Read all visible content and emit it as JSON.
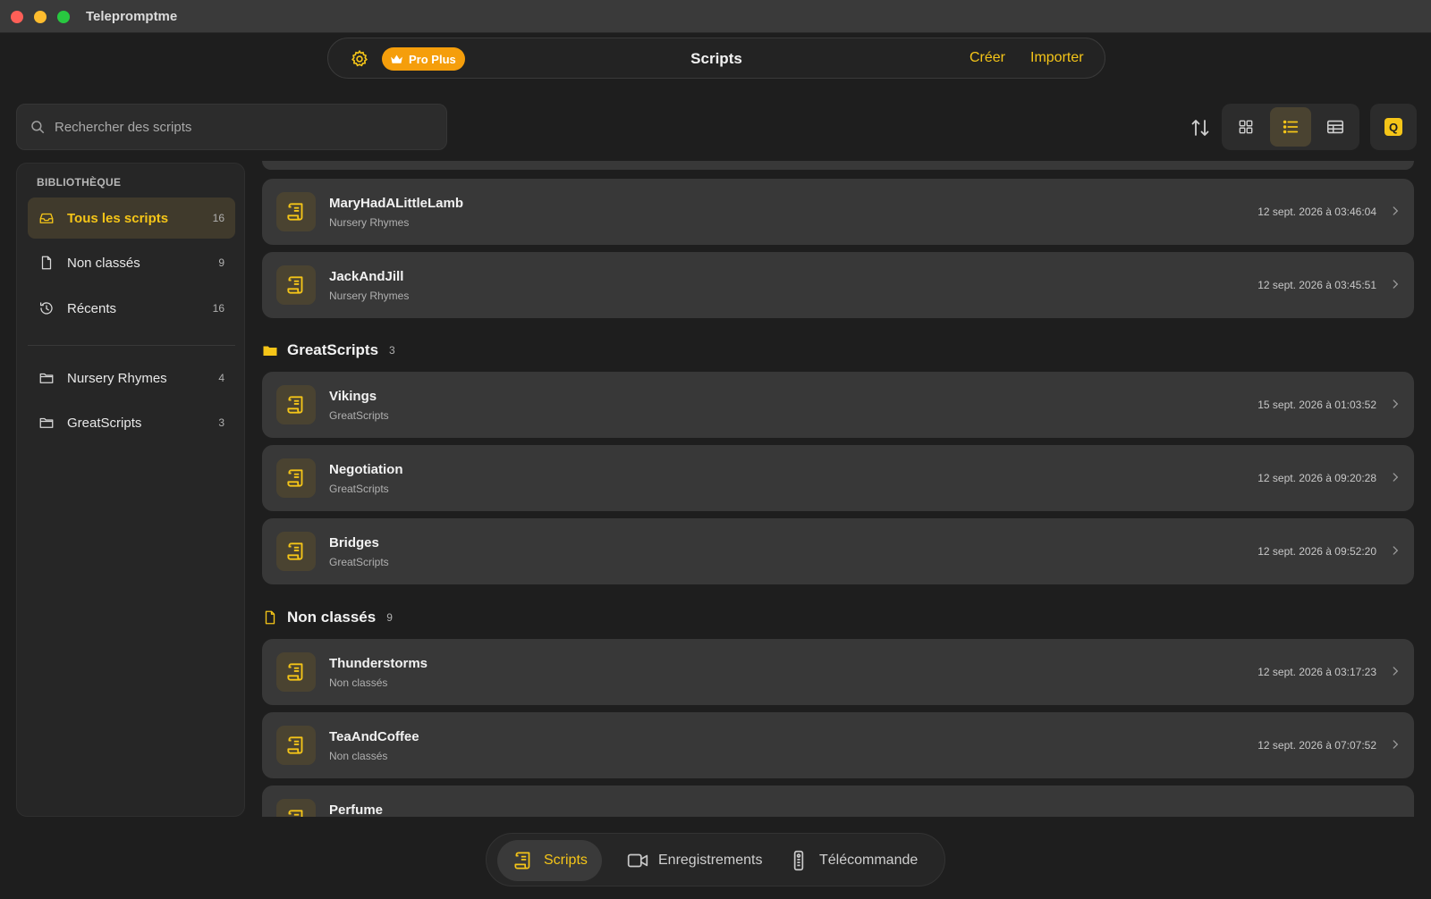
{
  "window": {
    "title": "Telepromptme"
  },
  "topnav": {
    "badge": "Pro Plus",
    "title": "Scripts",
    "create_label": "Créer",
    "import_label": "Importer"
  },
  "search": {
    "placeholder": "Rechercher des scripts"
  },
  "toolbar": {
    "q_label": "Q"
  },
  "sidebar": {
    "header": "BIBLIOTHÈQUE",
    "items": [
      {
        "label": "Tous les scripts",
        "count": "16",
        "icon": "tray-icon"
      },
      {
        "label": "Non classés",
        "count": "9",
        "icon": "document-icon"
      },
      {
        "label": "Récents",
        "count": "16",
        "icon": "clock-history-icon"
      }
    ],
    "folders": [
      {
        "label": "Nursery Rhymes",
        "count": "4",
        "icon": "folder-icon"
      },
      {
        "label": "GreatScripts",
        "count": "3",
        "icon": "folder-icon"
      }
    ]
  },
  "content": {
    "nursery": [
      {
        "title": "MaryHadALittleLamb",
        "folder": "Nursery Rhymes",
        "date": "12 sept. 2026 à 03:46:04"
      },
      {
        "title": "JackAndJill",
        "folder": "Nursery Rhymes",
        "date": "12 sept. 2026 à 03:45:51"
      }
    ],
    "great_section": {
      "title": "GreatScripts",
      "count": "3"
    },
    "great": [
      {
        "title": "Vikings",
        "folder": "GreatScripts",
        "date": "15 sept. 2026 à 01:03:52"
      },
      {
        "title": "Negotiation",
        "folder": "GreatScripts",
        "date": "12 sept. 2026 à 09:20:28"
      },
      {
        "title": "Bridges",
        "folder": "GreatScripts",
        "date": "12 sept. 2026 à 09:52:20"
      }
    ],
    "unclassified_section": {
      "title": "Non classés",
      "count": "9"
    },
    "unclassified": [
      {
        "title": "Thunderstorms",
        "folder": "Non classés",
        "date": "12 sept. 2026 à 03:17:23"
      },
      {
        "title": "TeaAndCoffee",
        "folder": "Non classés",
        "date": "12 sept. 2026 à 07:07:52"
      },
      {
        "title": "Perfume",
        "folder": "",
        "date": ""
      }
    ]
  },
  "tabs": [
    {
      "label": "Scripts",
      "icon": "scroll-icon"
    },
    {
      "label": "Enregistrements",
      "icon": "video-camera-icon"
    },
    {
      "label": "Télécommande",
      "icon": "remote-icon"
    }
  ],
  "colors": {
    "accent": "#f5c518",
    "badge": "#f59e0b",
    "background": "#1e1e1e",
    "card": "#383838"
  }
}
